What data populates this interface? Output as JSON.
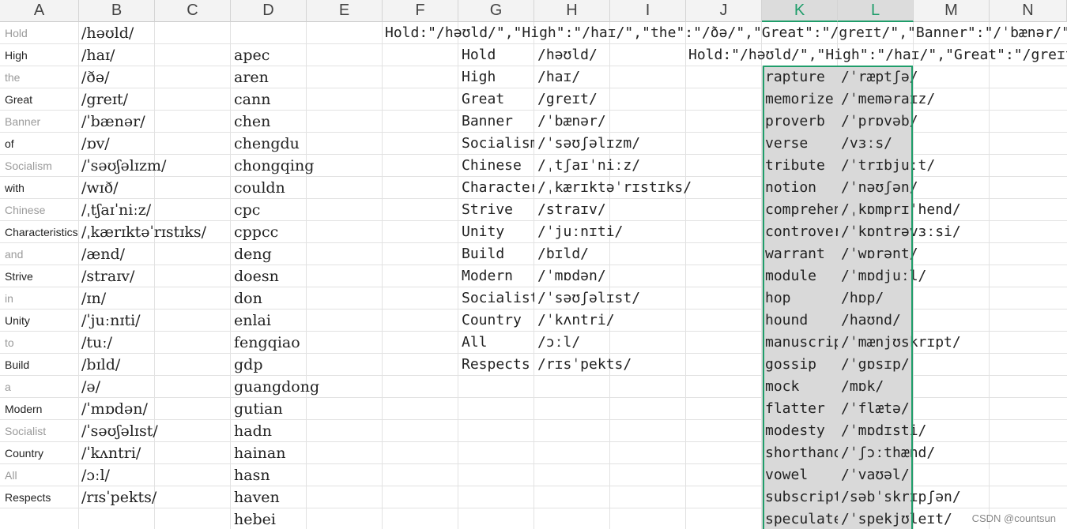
{
  "columns": [
    "A",
    "B",
    "C",
    "D",
    "E",
    "F",
    "G",
    "H",
    "I",
    "J",
    "K",
    "L",
    "M",
    "N"
  ],
  "colA": [
    "Hold",
    "High",
    "the",
    "Great",
    "Banner",
    "of",
    "Socialism",
    "with",
    "Chinese",
    "Characteristics",
    "and",
    "Strive",
    "in",
    "Unity",
    "to",
    "Build",
    "a",
    "Modern",
    "Socialist",
    "Country",
    "All",
    "Respects"
  ],
  "colA_gray": [
    true,
    false,
    true,
    false,
    true,
    false,
    true,
    false,
    true,
    false,
    true,
    false,
    true,
    false,
    true,
    false,
    true,
    false,
    true,
    false,
    true,
    false
  ],
  "colB": [
    "/həʊld/",
    "/haɪ/",
    "/ðə/",
    "/greɪt/",
    "/ˈbænər/",
    "/ɒv/",
    "/ˈsəʊʃəlɪzm/",
    "/wɪð/",
    "/ˌtʃaɪˈniːz/",
    "/ˌkærɪktəˈrɪstɪks/",
    "/ænd/",
    "/straɪv/",
    "/ɪn/",
    "/ˈjuːnɪti/",
    "/tuː/",
    "/bɪld/",
    "/ə/",
    "/ˈmɒdən/",
    "/ˈsəʊʃəlɪst/",
    "/ˈkʌntri/",
    "/ɔːl/",
    "/rɪsˈpekts/"
  ],
  "colD": [
    "apec",
    "aren",
    "cann",
    "chen",
    "chengdu",
    "chongqing",
    "couldn",
    "cpc",
    "cppcc",
    "deng",
    "doesn",
    "don",
    "enlai",
    "fengqiao",
    "gdp",
    "guangdong",
    "gutian",
    "hadn",
    "hainan",
    "hasn",
    "haven",
    "hebei"
  ],
  "row1_F": "Hold:\"/həʊld/\",\"High\":\"/haɪ/\",\"the\":\"/ðə/\",\"Great\":\"/greɪt/\",\"Banner\":\"/ˈbænər/\"",
  "row2_J": "Hold:\"/həʊld/\",\"High\":\"/haɪ/\",\"Great\":\"/greɪt/\"",
  "colG": [
    "Hold",
    "High",
    "Great",
    "Banner",
    "Socialism",
    "Chinese",
    "Characteristics",
    "Strive",
    "Unity",
    "Build",
    "Modern",
    "Socialist",
    "Country",
    "All",
    "Respects"
  ],
  "colH": [
    "/həʊld/",
    "/haɪ/",
    "/greɪt/",
    "/ˈbænər/",
    "/ˈsəʊʃəlɪzm/",
    "/ˌtʃaɪˈniːz/",
    "/ˌkærɪktəˈrɪstɪks/",
    "/straɪv/",
    "/ˈjuːnɪti/",
    "/bɪld/",
    "/ˈmɒdən/",
    "/ˈsəʊʃəlɪst/",
    "/ˈkʌntri/",
    "/ɔːl/",
    "/rɪsˈpekts/"
  ],
  "colK": [
    "rapture",
    "memorize",
    "proverb",
    "verse",
    "tribute",
    "notion",
    "comprehend",
    "controversy",
    "warrant",
    "module",
    "hop",
    "hound",
    "manuscript",
    "gossip",
    "mock",
    "flatter",
    "modesty",
    "shorthand",
    "vowel",
    "subscription",
    "speculate"
  ],
  "colL": [
    "/ˈræptʃə/",
    "/ˈmeməraɪz/",
    "/ˈprɒvəb/",
    "/vɜːs/",
    "/ˈtrɪbjuːt/",
    "/ˈnəʊʃən/",
    "/ˌkɒmprɪˈhend/",
    "/ˈkɒntrəvɜːsi/",
    "/ˈwɒrənt/",
    "/ˈmɒdjuːl/",
    "/hɒp/",
    "/haʊnd/",
    "/ˈmænjʊskrɪpt/",
    "/ˈgɒsɪp/",
    "/mɒk/",
    "/ˈflætə/",
    "/ˈmɒdɪsti/",
    "/ˈʃɔːthænd/",
    "/ˈvaʊəl/",
    "/səbˈskrɪpʃən/",
    "/ˈspekjʊleɪt/"
  ],
  "watermark": "CSDN @countsun",
  "colors": {
    "selection": "#1f9d6a",
    "selected_fill": "#d9d9d9",
    "header_bg": "#f3f3f3"
  }
}
